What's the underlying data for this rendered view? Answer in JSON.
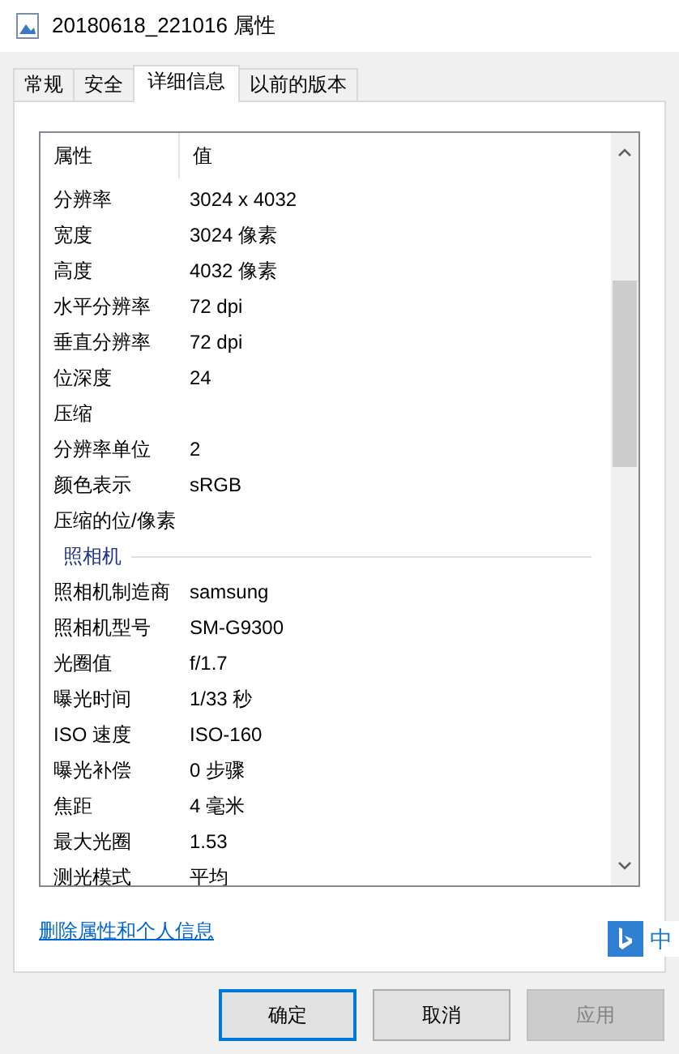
{
  "window": {
    "title": "20180618_221016 属性"
  },
  "tabs": [
    {
      "label": "常规",
      "selected": false
    },
    {
      "label": "安全",
      "selected": false
    },
    {
      "label": "详细信息",
      "selected": true
    },
    {
      "label": "以前的版本",
      "selected": false
    }
  ],
  "table": {
    "columns": [
      "属性",
      "值"
    ],
    "rows": [
      {
        "kind": "row",
        "name": "分辨率",
        "value": "3024 x 4032"
      },
      {
        "kind": "row",
        "name": "宽度",
        "value": "3024 像素"
      },
      {
        "kind": "row",
        "name": "高度",
        "value": "4032 像素"
      },
      {
        "kind": "row",
        "name": "水平分辨率",
        "value": "72 dpi"
      },
      {
        "kind": "row",
        "name": "垂直分辨率",
        "value": "72 dpi"
      },
      {
        "kind": "row",
        "name": "位深度",
        "value": "24"
      },
      {
        "kind": "row",
        "name": "压缩"
      },
      {
        "kind": "row",
        "name": "分辨率单位",
        "value": "2"
      },
      {
        "kind": "row",
        "name": "颜色表示",
        "value": "sRGB"
      },
      {
        "kind": "row",
        "name": "压缩的位/像素"
      },
      {
        "kind": "section",
        "name": "照相机"
      },
      {
        "kind": "row",
        "name": "照相机制造商",
        "value": "samsung"
      },
      {
        "kind": "row",
        "name": "照相机型号",
        "value": "SM-G9300"
      },
      {
        "kind": "row",
        "name": "光圈值",
        "value": "f/1.7"
      },
      {
        "kind": "row",
        "name": "曝光时间",
        "value": "1/33 秒"
      },
      {
        "kind": "row",
        "name": "ISO 速度",
        "value": "ISO-160"
      },
      {
        "kind": "row",
        "name": "曝光补偿",
        "value": "0 步骤"
      },
      {
        "kind": "row",
        "name": "焦距",
        "value": "4 毫米"
      },
      {
        "kind": "row",
        "name": "最大光圈",
        "value": "1.53"
      },
      {
        "kind": "row",
        "name": "测光模式",
        "value": "平均"
      }
    ]
  },
  "link": "删除属性和个人信息",
  "ime": {
    "label": "中"
  },
  "buttons": [
    {
      "label": "确定",
      "default": true,
      "disabled": false
    },
    {
      "label": "取消",
      "default": false,
      "disabled": false
    },
    {
      "label": "应用",
      "default": false,
      "disabled": true
    }
  ]
}
